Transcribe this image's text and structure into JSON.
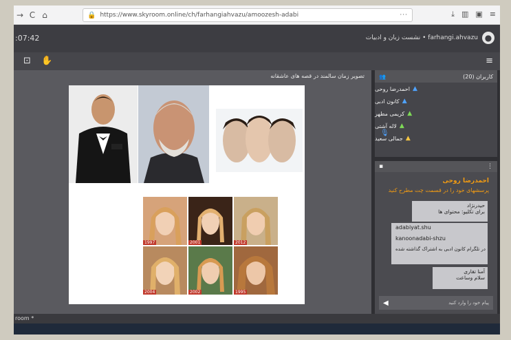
{
  "browser": {
    "back": "→",
    "reload": "C",
    "home": "⌂",
    "url": "https://www.skyroom.online/ch/farhangiahvazu/amoozesh-adabi",
    "menu_dots": "···"
  },
  "app": {
    "timer": ":07:42",
    "room_title": "farhangi.ahvazu • نشست زبان و ادبیات",
    "presentation_title": "تصویر زمان سالمند در قصه های عاشقانه"
  },
  "users": {
    "header": "کاربران (20)",
    "list": [
      {
        "name": "احمدرضا روحی",
        "color": "#4fa3ff"
      },
      {
        "name": "کانون ادبی",
        "color": "#4fa3ff"
      },
      {
        "name": "کریمی مطهر",
        "color": "#7ed957"
      },
      {
        "name": "لاله آشتی",
        "color": "#7ed957"
      },
      {
        "name": "جمالی سعید",
        "color": "#f5c542"
      }
    ]
  },
  "chat": {
    "notice_name": "احمدرضا روحی",
    "notice_message": "پرسشهای خود را در قسمت چت مطرح کنید",
    "messages": [
      {
        "author": "حیدرنژاد",
        "text": "برای تکلیو: محتوای ها"
      },
      {
        "text": "adabiyat.shu"
      },
      {
        "text": "kanoonadabi-shzu"
      },
      {
        "text": "در تلگرام کانون ادبی به اشتراک گذاشته شده"
      },
      {
        "author": "آمنا تقاری",
        "text": "سلام وساعت"
      }
    ],
    "input_placeholder": "پیام خود را وارد کنید"
  },
  "slide": {
    "years": [
      "1997",
      "2001",
      "2012",
      "2004",
      "2002",
      "1995"
    ]
  },
  "status": {
    "text": "room *"
  }
}
